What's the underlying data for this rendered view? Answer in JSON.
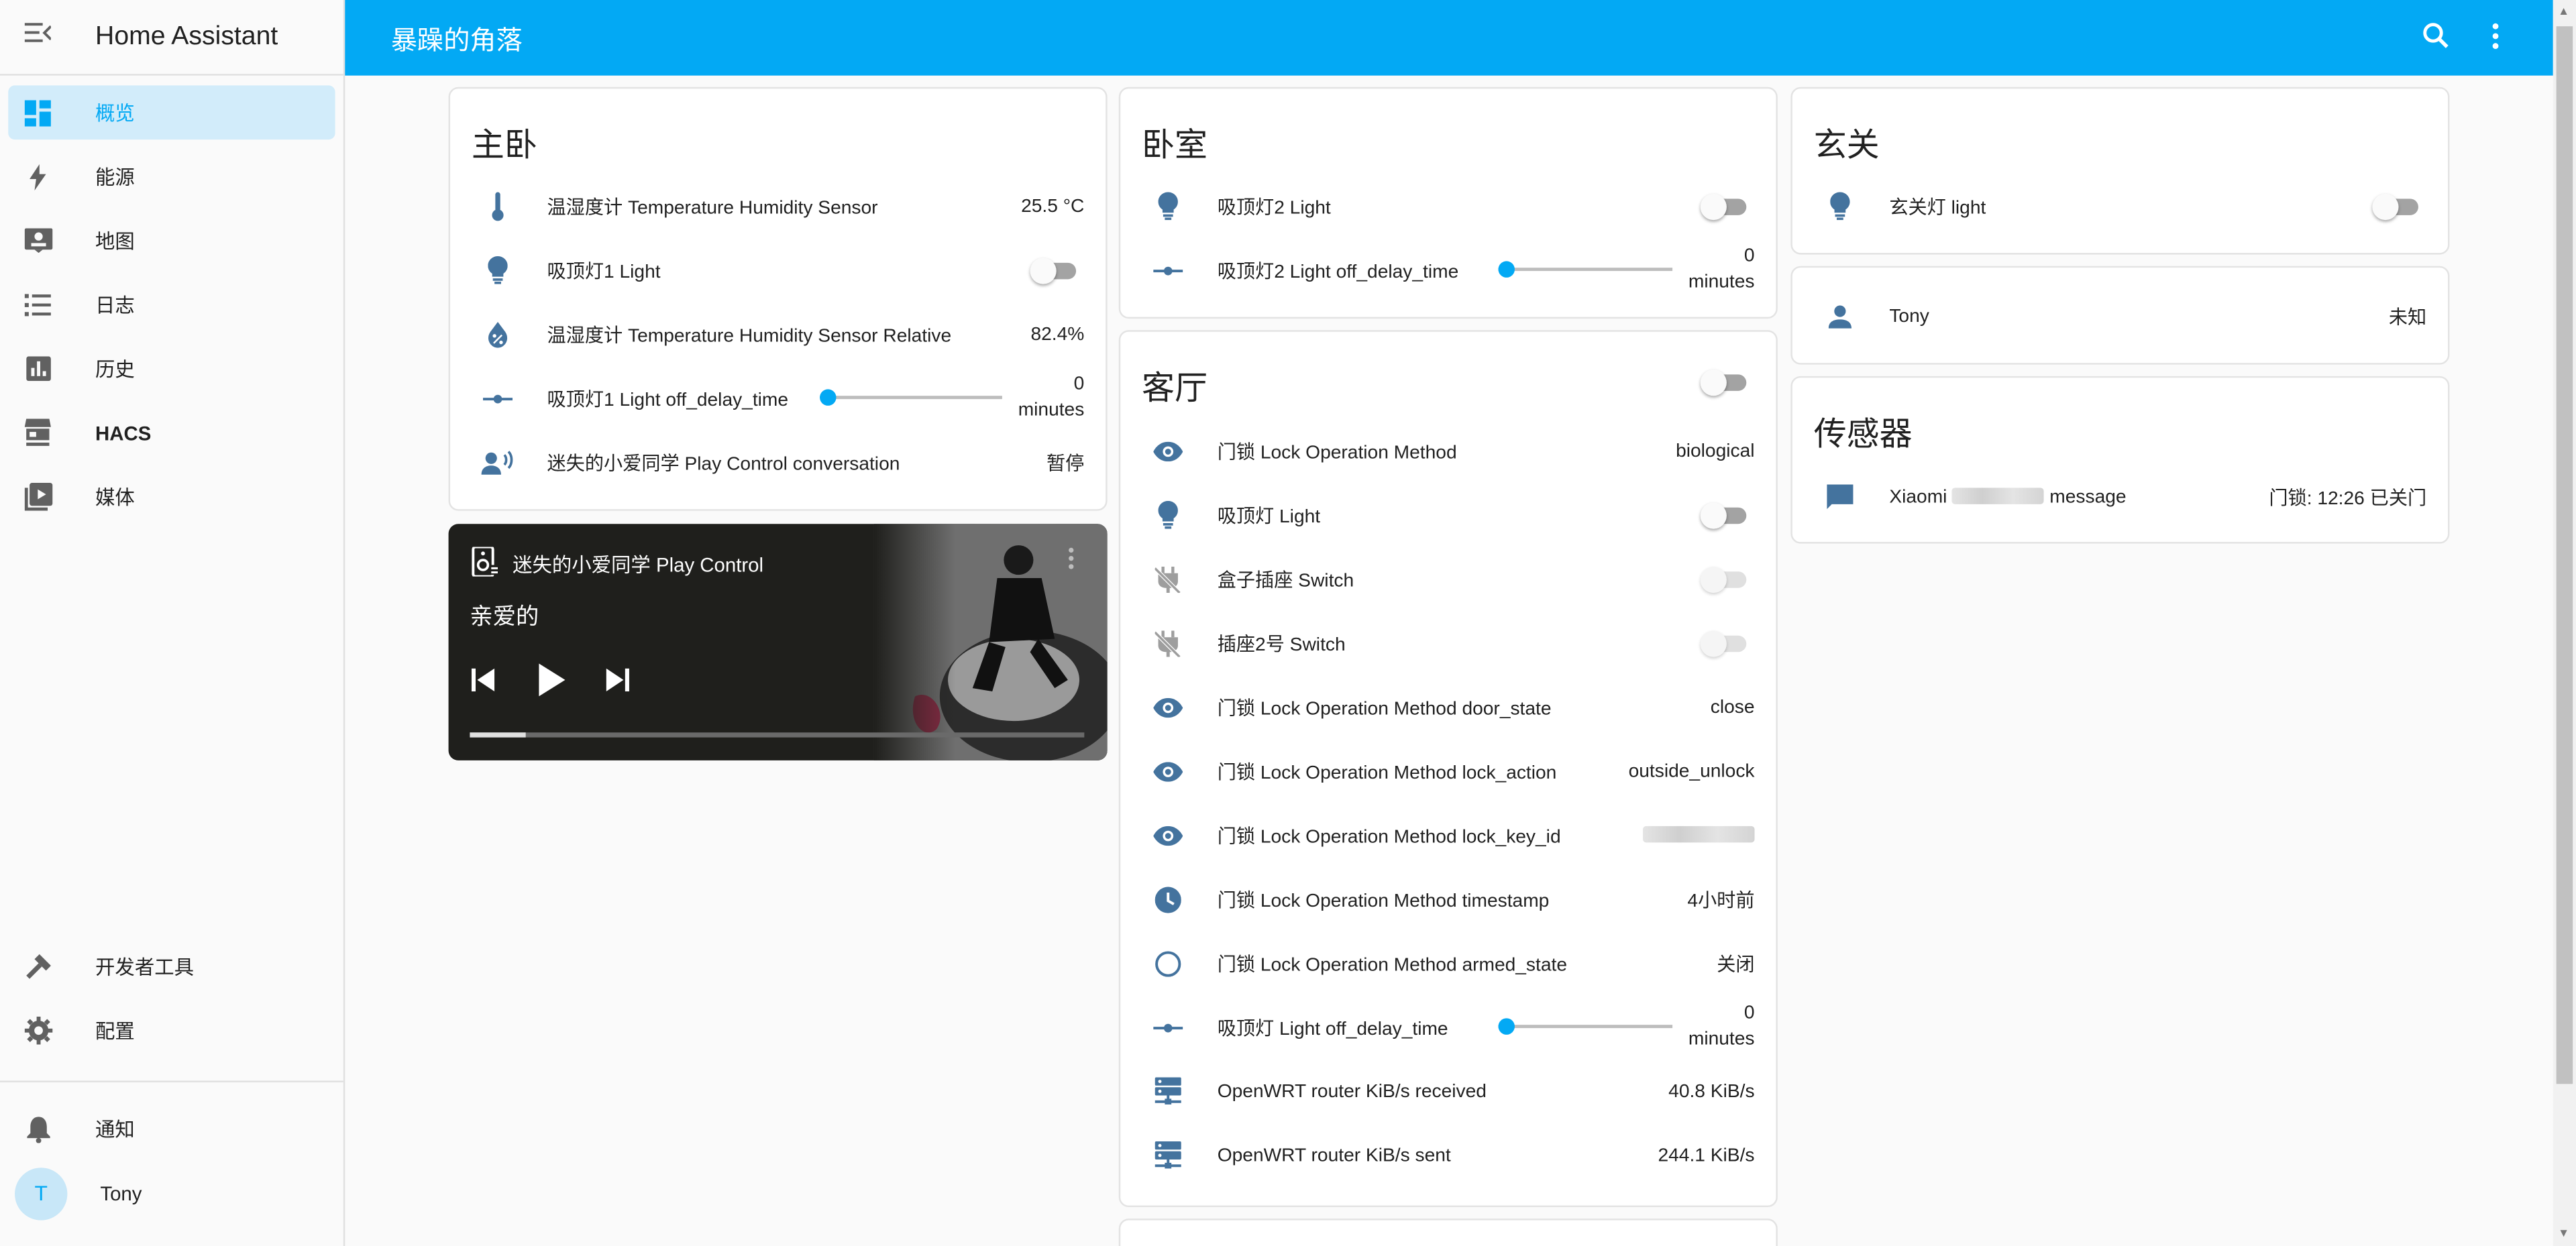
{
  "app": {
    "title": "Home Assistant",
    "header_title": "暴躁的角落"
  },
  "sidebar": {
    "items": [
      {
        "label": "概览",
        "icon": "dashboard-icon"
      },
      {
        "label": "能源",
        "icon": "lightning-icon"
      },
      {
        "label": "地图",
        "icon": "map-icon"
      },
      {
        "label": "日志",
        "icon": "list-icon"
      },
      {
        "label": "历史",
        "icon": "chart-icon"
      },
      {
        "label": "HACS",
        "icon": "hacs-icon"
      },
      {
        "label": "媒体",
        "icon": "media-icon"
      }
    ],
    "developer_tools": "开发者工具",
    "config": "配置",
    "notifications": "通知",
    "user_initial": "T",
    "user_name": "Tony"
  },
  "cards": {
    "master_bedroom": {
      "title": "主卧",
      "rows": [
        {
          "name": "温湿度计 Temperature Humidity Sensor",
          "value": "25.5 °C"
        },
        {
          "name": "吸顶灯1 Light"
        },
        {
          "name": "温湿度计 Temperature Humidity Sensor Relative",
          "value": "82.4%"
        },
        {
          "name": "吸顶灯1 Light off_delay_time",
          "value": "0",
          "unit": "minutes",
          "slider_fraction": 0
        },
        {
          "name": "迷失的小爱同学 Play Control conversation",
          "value": "暂停"
        }
      ]
    },
    "media_player": {
      "name": "迷失的小爱同学 Play Control",
      "track": "亲爱的",
      "progress_fraction": 0.09
    },
    "bedroom": {
      "title": "卧室",
      "rows": [
        {
          "name": "吸顶灯2 Light"
        },
        {
          "name": "吸顶灯2 Light off_delay_time",
          "value": "0",
          "unit": "minutes",
          "slider_fraction": 0
        }
      ]
    },
    "living_room": {
      "title": "客厅",
      "rows": [
        {
          "name": "门锁 Lock Operation Method",
          "value": "biological"
        },
        {
          "name": "吸顶灯 Light"
        },
        {
          "name": "盒子插座 Switch"
        },
        {
          "name": "插座2号 Switch"
        },
        {
          "name": "门锁 Lock Operation Method door_state",
          "value": "close"
        },
        {
          "name": "门锁 Lock Operation Method lock_action",
          "value": "outside_unlock"
        },
        {
          "name": "门锁 Lock Operation Method lock_key_id"
        },
        {
          "name": "门锁 Lock Operation Method timestamp",
          "value": "4小时前"
        },
        {
          "name": "门锁 Lock Operation Method armed_state",
          "value": "关闭"
        },
        {
          "name": "吸顶灯 Light off_delay_time",
          "value": "0",
          "unit": "minutes",
          "slider_fraction": 0
        },
        {
          "name": "OpenWRT router KiB/s received",
          "value": "40.8 KiB/s"
        },
        {
          "name": "OpenWRT router KiB/s sent",
          "value": "244.1 KiB/s"
        }
      ]
    },
    "entrance": {
      "title": "玄关",
      "rows": [
        {
          "name": "玄关灯 light"
        }
      ]
    },
    "person": {
      "name": "Tony",
      "state": "未知"
    },
    "sensors": {
      "title": "传感器",
      "row_name_prefix": "Xiaomi",
      "row_name_suffix": "message",
      "row_value": "门锁: 12:26 已关门"
    }
  },
  "colors": {
    "primary": "#03a9f4",
    "icon": "#44739e",
    "sidebar_active_bg": "#d2ecfa"
  }
}
